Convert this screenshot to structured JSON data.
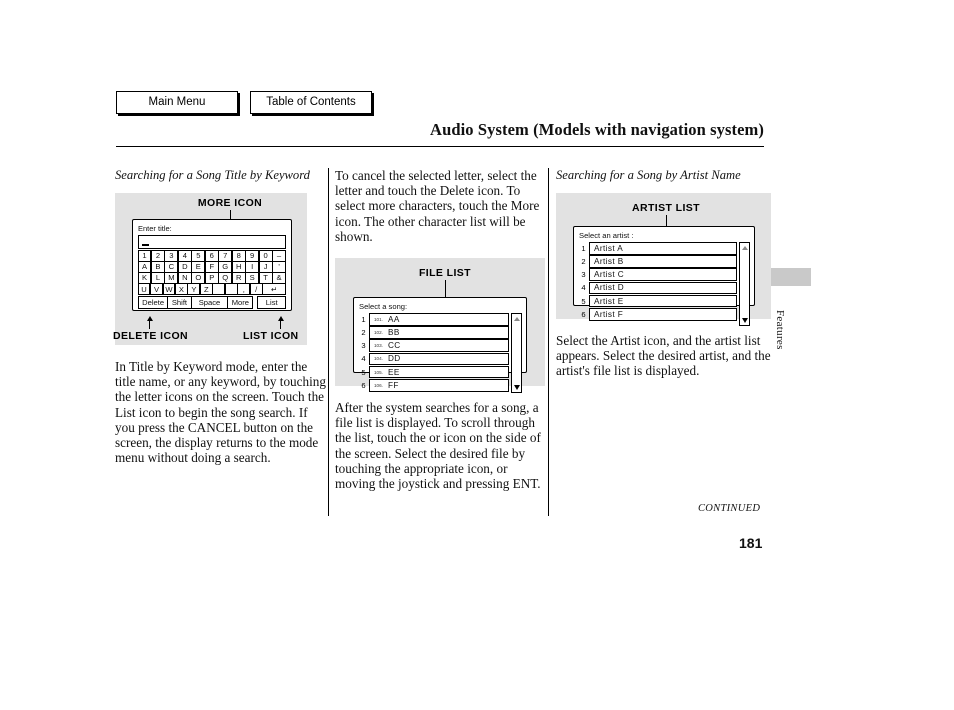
{
  "nav": {
    "main_menu": "Main Menu",
    "table_of_contents": "Table of Contents"
  },
  "header": {
    "title": "Audio System (Models with navigation system)"
  },
  "side_tab": {
    "label": "Features",
    "color": "#c9c9c9"
  },
  "columns": {
    "left": {
      "heading": "Searching for a Song Title by Keyword",
      "figure": {
        "callout_top": "MORE ICON",
        "callout_bottom_left": "DELETE ICON",
        "callout_bottom_right": "LIST ICON",
        "screen_label": "Enter title:",
        "keyboard_rows": [
          [
            "1",
            "2",
            "3",
            "4",
            "5",
            "6",
            "7",
            "8",
            "9",
            "0",
            "–"
          ],
          [
            "A",
            "B",
            "C",
            "D",
            "E",
            "F",
            "G",
            "H",
            "I",
            "J",
            "'"
          ],
          [
            "K",
            "L",
            "M",
            "N",
            "O",
            "P",
            "Q",
            "R",
            "S",
            "T",
            "&"
          ],
          [
            "U",
            "V",
            "W",
            "X",
            "Y",
            "Z",
            "",
            "",
            ",",
            "/",
            "↵"
          ]
        ],
        "bottom_keys": [
          "Delete",
          "Shift",
          "Space",
          "More",
          "List"
        ]
      },
      "body": "In Title by Keyword mode, enter the title name, or any keyword, by touching the letter icons on the screen. Touch the List icon to begin the song search. If you press the CANCEL button on the screen, the display returns to the mode menu without doing a search."
    },
    "middle": {
      "body_top": "To cancel the selected letter, select the letter and touch the Delete icon. To select more characters, touch the More icon. The other character list will be shown.",
      "figure": {
        "callout_top": "FILE LIST",
        "screen_label": "Select a song:",
        "rows": [
          {
            "num": "1",
            "index": "101.",
            "text": "AA"
          },
          {
            "num": "2",
            "index": "102.",
            "text": "BB"
          },
          {
            "num": "3",
            "index": "103.",
            "text": "CC"
          },
          {
            "num": "4",
            "index": "104.",
            "text": "DD"
          },
          {
            "num": "5",
            "index": "105.",
            "text": "EE"
          },
          {
            "num": "6",
            "index": "106.",
            "text": "FF"
          }
        ]
      },
      "body_bottom": "After the system searches for a song, a file list is displayed. To scroll through the list, touch the      or icon on the side of the screen. Select the desired file by touching the appropriate icon, or moving the joystick and pressing ENT."
    },
    "right": {
      "heading": "Searching for a Song by Artist Name",
      "figure": {
        "callout_top": "ARTIST LIST",
        "screen_label": "Select an artist :",
        "rows": [
          {
            "num": "1",
            "text": "Artist  A"
          },
          {
            "num": "2",
            "text": "Artist  B"
          },
          {
            "num": "3",
            "text": "Artist  C"
          },
          {
            "num": "4",
            "text": "Artist  D"
          },
          {
            "num": "5",
            "text": "Artist  E"
          },
          {
            "num": "6",
            "text": "Artist  F"
          }
        ]
      },
      "body": "Select the Artist icon, and the artist list appears. Select the desired artist, and the artist's file list is displayed."
    }
  },
  "footer": {
    "continued": "CONTINUED",
    "page_number": "181"
  }
}
